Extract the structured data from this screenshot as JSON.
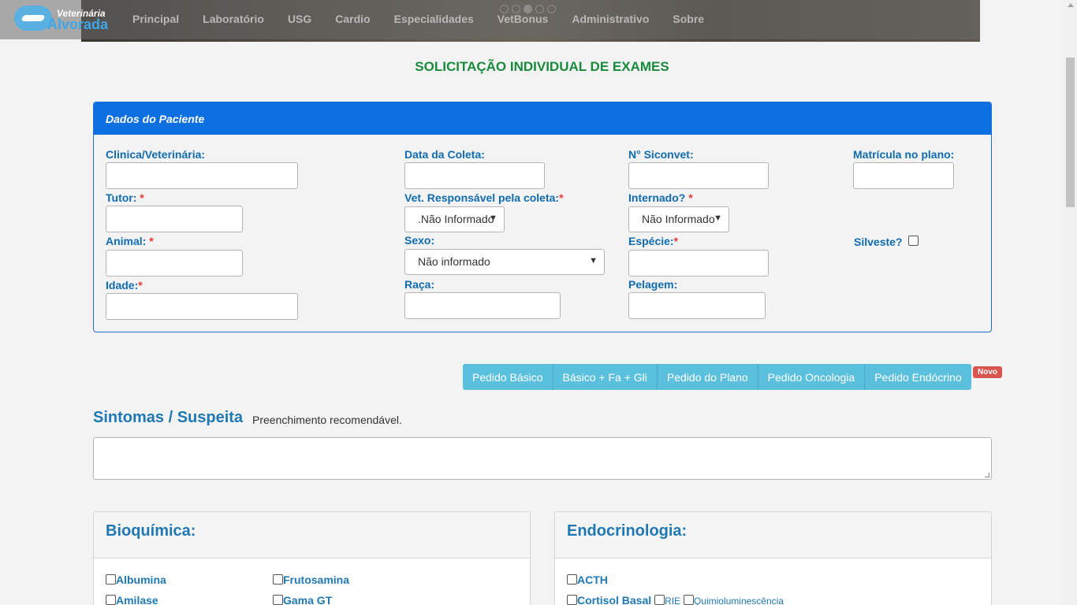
{
  "header": {
    "logo_line1": "Veterinária",
    "logo_line2": "Alvorada",
    "nav": [
      "Principal",
      "Laboratório",
      "USG",
      "Cardio",
      "Especialidades",
      "VetBonus",
      "Administrativo",
      "Sobre"
    ],
    "carousel_active_index": 2
  },
  "page_title": "SOLICITAÇÃO INDIVIDUAL DE EXAMES",
  "patient": {
    "panel_title": "Dados do Paciente",
    "clinica_label": "Clinica/Veterinária:",
    "data_coleta_label": "Data da Coleta:",
    "siconvet_label": "N° Siconvet:",
    "matricula_label": "Matrícula no plano:",
    "tutor_label": "Tutor:",
    "vet_label": "Vet. Responsável pela coleta:",
    "vet_value": ".Não Informado",
    "internado_label": "Internado?",
    "internado_value": "Não Informado",
    "animal_label": "Animal:",
    "sexo_label": "Sexo:",
    "sexo_value": "Não informado",
    "especie_label": "Espécie:",
    "silvestre_label": "Silveste?",
    "idade_label": "Idade:",
    "raca_label": "Raça:",
    "pelagem_label": "Pelagem:",
    "required_mark": "*"
  },
  "pedido_buttons": [
    "Pedido Básico",
    "Básico + Fa + Gli",
    "Pedido do Plano",
    "Pedido Oncologia",
    "Pedido Endócrino"
  ],
  "badge_novo": "Novo",
  "sintomas": {
    "title": "Sintomas / Suspeita",
    "note": "Preenchimento recomendável."
  },
  "bioquimica": {
    "title": "Bioquímica:",
    "items": [
      "Albumina",
      "Frutosamina",
      "Amilase",
      "Gama GT"
    ]
  },
  "endocrinologia": {
    "title": "Endocrinologia:",
    "acth": "ACTH",
    "cortisol": "Cortisol Basal",
    "rie": "RIE",
    "quimio": "Quimioluminescência"
  }
}
